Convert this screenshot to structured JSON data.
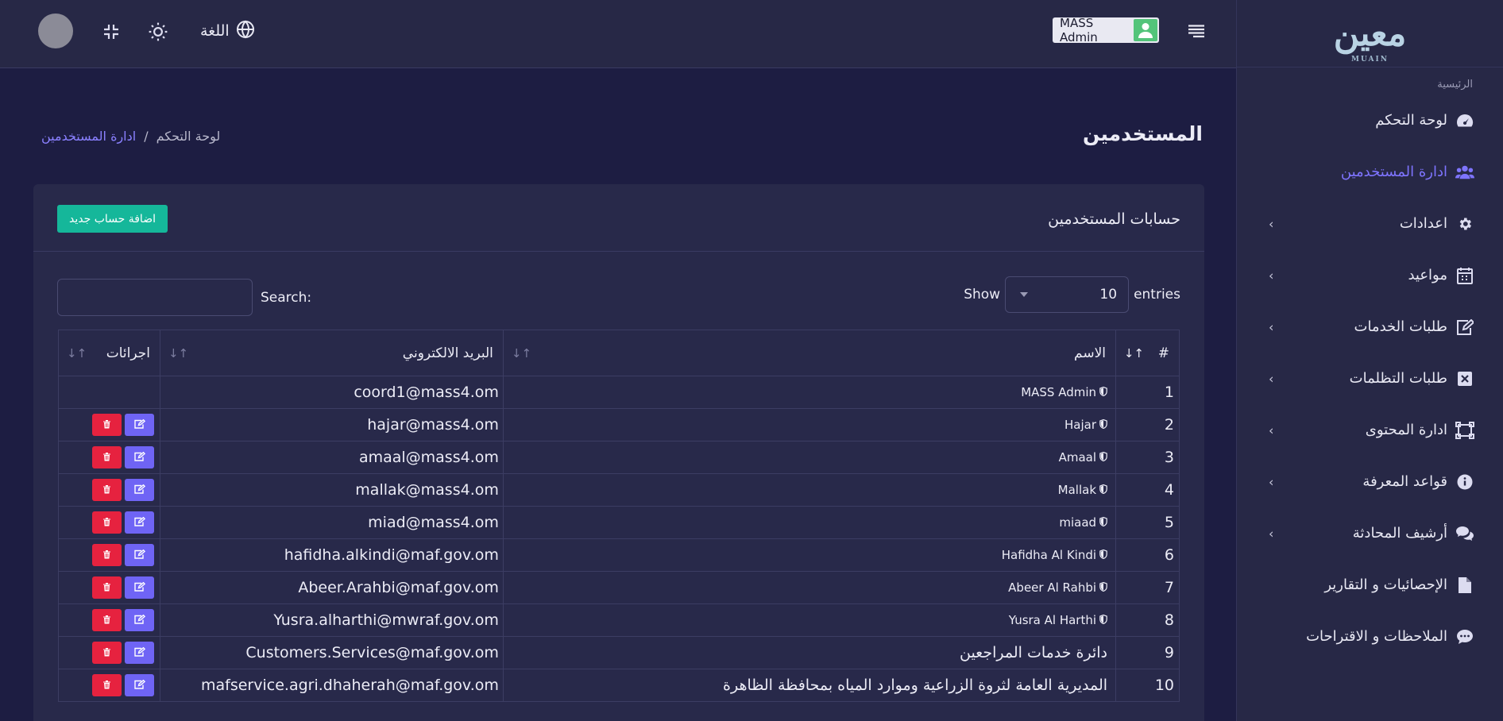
{
  "topbar": {
    "language_label": "اللغة",
    "user_name": "MASS Admin"
  },
  "sidebar": {
    "logo_text": "معين",
    "logo_sub": "MUAIN",
    "section_label": "الرئيسية",
    "items": [
      {
        "label": "لوحة التحكم",
        "icon": "dashboard-icon",
        "active": false,
        "has_submenu": false
      },
      {
        "label": "ادارة المستخدمين",
        "icon": "users-icon",
        "active": true,
        "has_submenu": false
      },
      {
        "label": "اعدادات",
        "icon": "gear-icon",
        "active": false,
        "has_submenu": true
      },
      {
        "label": "مواعيد",
        "icon": "calendar-icon",
        "active": false,
        "has_submenu": true
      },
      {
        "label": "طلبات الخدمات",
        "icon": "edit-icon",
        "active": false,
        "has_submenu": true
      },
      {
        "label": "طلبات التظلمات",
        "icon": "x-box-icon",
        "active": false,
        "has_submenu": true
      },
      {
        "label": "ادارة المحتوى",
        "icon": "frame-icon",
        "active": false,
        "has_submenu": true
      },
      {
        "label": "قواعد المعرفة",
        "icon": "info-icon",
        "active": false,
        "has_submenu": true
      },
      {
        "label": "أرشيف المحادثة",
        "icon": "chat-icon",
        "active": false,
        "has_submenu": true
      },
      {
        "label": "الإحصائيات و التقارير",
        "icon": "file-icon",
        "active": false,
        "has_submenu": false
      },
      {
        "label": "الملاحظات و الاقتراحات",
        "icon": "comment-icon",
        "active": false,
        "has_submenu": false
      }
    ]
  },
  "page": {
    "title": "المستخدمين",
    "breadcrumb_home": "لوحة التحكم",
    "breadcrumb_sep": "/",
    "breadcrumb_current": "ادارة المستخدمين"
  },
  "card": {
    "title": "حسابات المستخدمين",
    "add_button": "اضافة حساب جديد",
    "show_label": "Show",
    "entries_label": "entries",
    "page_length": "10",
    "search_label": "Search:"
  },
  "table": {
    "headers": {
      "num": "#",
      "name": "الاسم",
      "email": "البريد الالكتروني",
      "actions": "اجرائات"
    },
    "rows": [
      {
        "num": "1",
        "name": "MASS Admin",
        "email": "coord1@mass4.om",
        "admin_badge": true,
        "actions": false
      },
      {
        "num": "2",
        "name": "Hajar",
        "email": "hajar@mass4.om",
        "admin_badge": true,
        "actions": true
      },
      {
        "num": "3",
        "name": "Amaal",
        "email": "amaal@mass4.om",
        "admin_badge": true,
        "actions": true
      },
      {
        "num": "4",
        "name": "Mallak",
        "email": "mallak@mass4.om",
        "admin_badge": true,
        "actions": true
      },
      {
        "num": "5",
        "name": "miaad",
        "email": "miad@mass4.om",
        "admin_badge": true,
        "actions": true
      },
      {
        "num": "6",
        "name": "Hafidha Al Kindi",
        "email": "hafidha.alkindi@maf.gov.om",
        "admin_badge": true,
        "actions": true
      },
      {
        "num": "7",
        "name": "Abeer Al Rahbi",
        "email": "Abeer.Arahbi@maf.gov.om",
        "admin_badge": true,
        "actions": true
      },
      {
        "num": "8",
        "name": "Yusra Al Harthi",
        "email": "Yusra.alharthi@mwraf.gov.om",
        "admin_badge": true,
        "actions": true
      },
      {
        "num": "9",
        "name": "دائرة خدمات المراجعين",
        "email": "Customers.Services@maf.gov.om",
        "admin_badge": false,
        "actions": true
      },
      {
        "num": "10",
        "name": "المديرية العامة لثروة الزراعية وموارد المياه بمحافظة الظاهرة",
        "email": "mafservice.agri.dhaherah@maf.gov.om",
        "admin_badge": false,
        "actions": true
      }
    ]
  }
}
